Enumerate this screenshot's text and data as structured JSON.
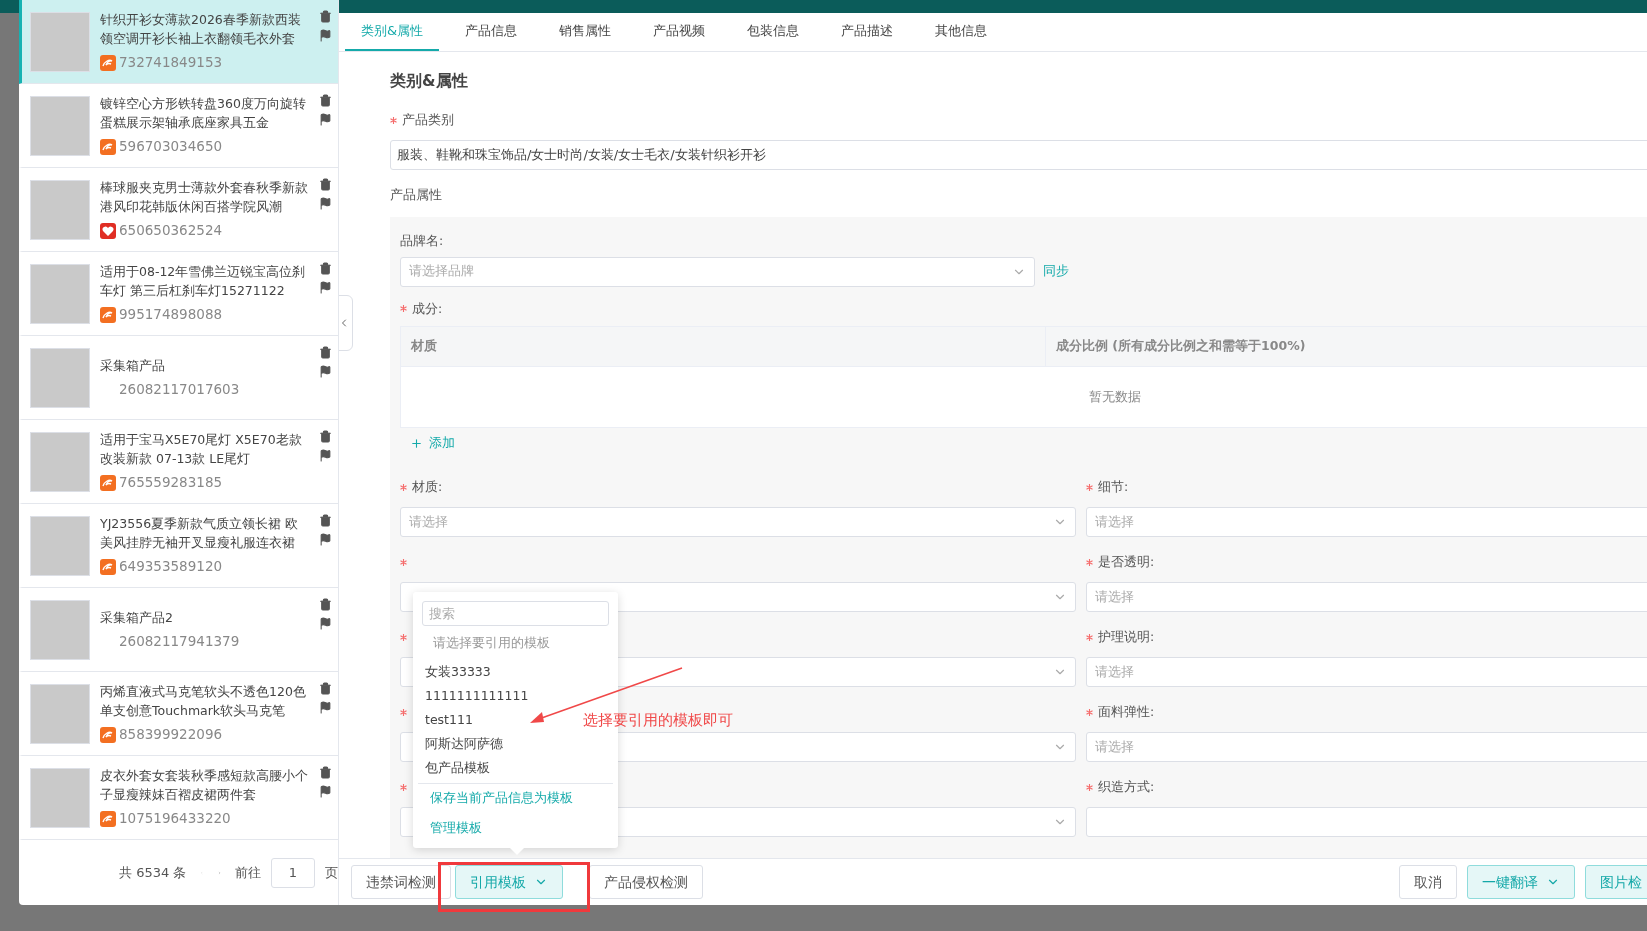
{
  "products": [
    {
      "title": "针织开衫女薄款2026春季新款西装领空调开衫长袖上衣翻领毛衣外套",
      "id": "732741849153",
      "kind": "alibaba",
      "selected": true
    },
    {
      "title": "镀锌空心方形铁转盘360度万向旋转蛋糕展示架轴承底座家具五金",
      "id": "596703034650",
      "kind": "alibaba",
      "selected": false
    },
    {
      "title": "棒球服夹克男士薄款外套春秋季新款港风印花韩版休闲百搭学院风潮",
      "id": "650650362524",
      "kind": "heart",
      "selected": false
    },
    {
      "title": "适用于08-12年雪佛兰迈锐宝高位刹车灯 第三后杠刹车灯15271122",
      "id": "995174898088",
      "kind": "alibaba",
      "selected": false
    },
    {
      "title": "采集箱产品",
      "id": "26082117017603",
      "kind": "plain",
      "selected": false
    },
    {
      "title": "适用于宝马X5E70尾灯  X5E70老款改装新款 07-13款 LE尾灯",
      "id": "765559283185",
      "kind": "alibaba",
      "selected": false
    },
    {
      "title": "YJ23556夏季新款气质立领长裙 欧美风挂脖无袖开叉显瘦礼服连衣裙",
      "id": "649353589120",
      "kind": "alibaba",
      "selected": false
    },
    {
      "title": "采集箱产品2",
      "id": "26082117941379",
      "kind": "plain",
      "selected": false
    },
    {
      "title": "丙烯直液式马克笔软头不透色120色单支创意Touchmark软头马克笔",
      "id": "858399922096",
      "kind": "alibaba",
      "selected": false
    },
    {
      "title": "皮衣外套女套装秋季感短款高腰小个子显瘦辣妹百褶皮裙两件套",
      "id": "1075196433220",
      "kind": "alibaba",
      "selected": false
    }
  ],
  "pagination": {
    "total": "共 6534 条",
    "goto": "前往",
    "page": "1",
    "unit": "页"
  },
  "tabs": [
    {
      "label": "类别&属性",
      "selected": true
    },
    {
      "label": "产品信息",
      "selected": false
    },
    {
      "label": "销售属性",
      "selected": false
    },
    {
      "label": "产品视频",
      "selected": false
    },
    {
      "label": "包装信息",
      "selected": false
    },
    {
      "label": "产品描述",
      "selected": false
    },
    {
      "label": "其他信息",
      "selected": false
    }
  ],
  "section_title": "类别&属性",
  "category": {
    "label": "产品类别",
    "required": true,
    "value": "服装、鞋靴和珠宝饰品/女士时尚/女装/女士毛衣/女装针织衫开衫"
  },
  "attributes_label": "产品属性",
  "brand": {
    "label": "品牌名:",
    "placeholder": "请选择品牌",
    "sync": "同步"
  },
  "composition": {
    "label": "成分:",
    "required": true,
    "columns": [
      "材质",
      "成分比例 (所有成分比例之和需等于100%)"
    ],
    "empty": "暂无数据",
    "add": "添加"
  },
  "fields": [
    {
      "label": "材质:",
      "required": true,
      "placeholder": "请选择"
    },
    {
      "label": "细节:",
      "required": true,
      "placeholder": "请选择"
    },
    {
      "required": true
    },
    {
      "label": "是否透明:",
      "required": true,
      "placeholder": "请选择"
    },
    {
      "required": true
    },
    {
      "label": "护理说明:",
      "required": true,
      "placeholder": "请选择"
    },
    {
      "required": true
    },
    {
      "label": "面料弹性:",
      "required": true,
      "placeholder": "请选择"
    },
    {
      "required": true
    },
    {
      "label": "织造方式:",
      "required": true
    }
  ],
  "template_menu": {
    "search_placeholder": "搜索",
    "hint": "请选择要引用的模板",
    "items": [
      "女装33333",
      "1111111111111",
      "test111",
      "阿斯达阿萨德",
      "包产品模板"
    ],
    "actions": [
      "保存当前产品信息为模板",
      "管理模板"
    ]
  },
  "annotation": {
    "text": "选择要引用的模板即可"
  },
  "footer_left": [
    {
      "label": "违禁词检测",
      "primary": false,
      "caret": false
    },
    {
      "label": "引用模板",
      "primary": true,
      "caret": true
    },
    {
      "label": "产品侵权检测",
      "primary": false,
      "caret": false
    }
  ],
  "footer_right": [
    {
      "label": "取消",
      "primary": false,
      "caret": false
    },
    {
      "label": "一键翻译",
      "primary": true,
      "caret": true
    },
    {
      "label": "图片检",
      "primary": true,
      "caret": false
    }
  ]
}
